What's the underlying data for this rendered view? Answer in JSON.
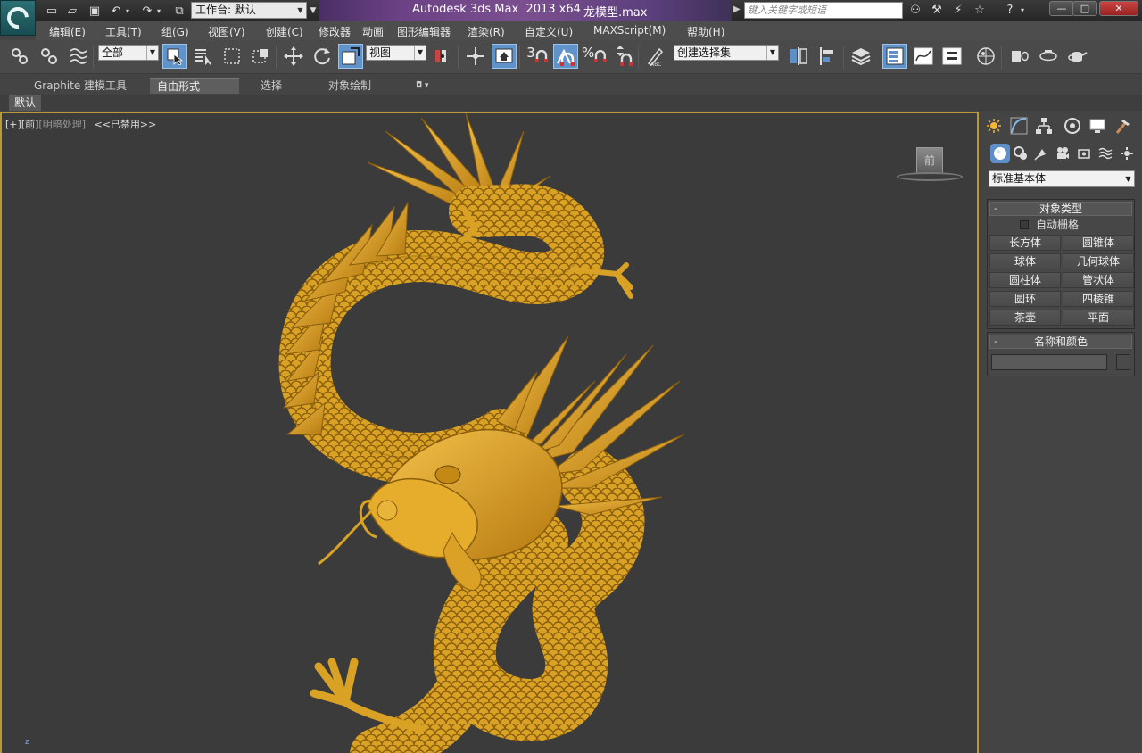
{
  "window": {
    "title": "Autodesk 3ds Max  2013 x64",
    "filename": "龙模型.max",
    "workspace_label": "工作台: 默认",
    "search_placeholder": "键入关键字或短语",
    "minimize": "—",
    "maximize": "□",
    "close": "✕"
  },
  "menu": {
    "items": [
      "编辑(E)",
      "工具(T)",
      "组(G)",
      "视图(V)",
      "创建(C)",
      "修改器",
      "动画",
      "图形编辑器",
      "渲染(R)",
      "自定义(U)",
      "MAXScript(M)",
      "帮助(H)"
    ]
  },
  "toolbar": {
    "selection_filter": "全部",
    "reference_coord": "视图",
    "snap_number": "3",
    "named_selection_sets": "创建选择集"
  },
  "ribbon": {
    "tabs": [
      "Graphite 建模工具",
      "自由形式",
      "选择",
      "对象绘制"
    ],
    "active_tab": "自由形式",
    "panel_label": "默认"
  },
  "viewport": {
    "label_plus": "[+]",
    "label_view": "[前]",
    "label_shading": "[明暗处理]",
    "label_disabled": "<<已禁用>>",
    "viewcube_face": "前",
    "axis_label": "z",
    "model_color": "#e0a92a"
  },
  "command_panel": {
    "category_dropdown": "标准基本体",
    "object_type_rollout": {
      "title": "对象类型",
      "autogrid_label": "自动栅格",
      "buttons": [
        "长方体",
        "圆锥体",
        "球体",
        "几何球体",
        "圆柱体",
        "管状体",
        "圆环",
        "四棱锥",
        "茶壶",
        "平面"
      ]
    },
    "name_color_rollout": {
      "title": "名称和颜色",
      "name_value": ""
    }
  },
  "colors": {
    "accent_blue": "#5e8fc6",
    "viewport_border": "#b89a3a",
    "dragon_gold": "#e0a92a"
  }
}
